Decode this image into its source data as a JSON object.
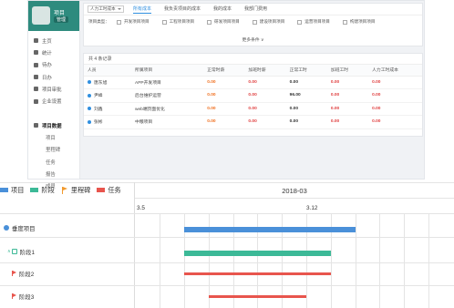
{
  "app": {
    "profile": {
      "name": "项目",
      "tag": "管理"
    },
    "nav": [
      {
        "label": "主页",
        "sub": false
      },
      {
        "label": "统计",
        "sub": false
      },
      {
        "label": "待办",
        "sub": false
      },
      {
        "label": "日办",
        "sub": false
      },
      {
        "label": "项目审批",
        "sub": false
      },
      {
        "label": "企业设置",
        "sub": false
      },
      {
        "label": "",
        "sub": false
      },
      {
        "label": "项目数据",
        "sub": false,
        "active": true
      },
      {
        "label": "项目",
        "sub": true
      },
      {
        "label": "里程碑",
        "sub": true
      },
      {
        "label": "任务",
        "sub": true
      },
      {
        "label": "报告",
        "sub": true
      },
      {
        "label": "成员",
        "sub": true
      }
    ],
    "filter": {
      "select_value": "人力工时成本",
      "tabs": [
        "所有成本",
        "我负责项目的成本",
        "我的成本",
        "我部门费用"
      ],
      "active_tab": 0,
      "type_label": "项目类型：",
      "types": [
        "开发项目项目",
        "工程项目项目",
        "研发项目项目",
        "建设项目项目",
        "运营项目项目",
        "构建项目项目"
      ],
      "more": "更多条件 ∨"
    },
    "table": {
      "count": "共 4 条记录",
      "headers": [
        "人员",
        "所属项目",
        "正常时薪",
        "加班时薪",
        "正常工时",
        "加班工时",
        "人力工时成本"
      ],
      "rows": [
        [
          "唐东旭",
          "APP开发项目",
          "0.00",
          "0.00",
          "0.00",
          "0.00",
          "0.00"
        ],
        [
          "尹峰",
          "后台维护运营",
          "0.00",
          "0.00",
          "96.00",
          "0.00",
          "0.00"
        ],
        [
          "刘鑫",
          "web端页面优化",
          "0.00",
          "0.00",
          "0.00",
          "0.00",
          "0.00"
        ],
        [
          "张彬",
          "中粮项目",
          "0.00",
          "0.00",
          "0.00",
          "0.00",
          "0.00"
        ]
      ]
    }
  },
  "gantt": {
    "legend": [
      {
        "label": "项目",
        "kind": "swatch",
        "color": "#4a90d9"
      },
      {
        "label": "阶段",
        "kind": "swatch",
        "color": "#3cb997"
      },
      {
        "label": "里程碑",
        "kind": "flag",
        "color": "#f29a2e"
      },
      {
        "label": "任务",
        "kind": "swatch",
        "color": "#e8554d"
      }
    ],
    "month": "2018-03",
    "days": [
      "3.5",
      "3.12"
    ],
    "rows": [
      {
        "label": "垂度项目",
        "type": "project"
      },
      {
        "label": "阶段1",
        "type": "phase"
      },
      {
        "label": "阶段2",
        "type": "task"
      },
      {
        "label": "阶段3",
        "type": "task"
      }
    ]
  }
}
